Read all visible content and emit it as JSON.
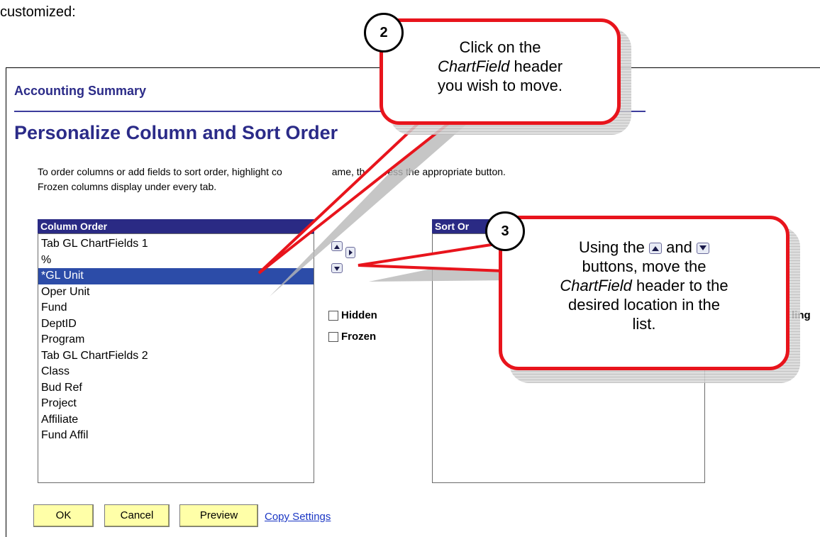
{
  "doc_text": "customized:",
  "page": {
    "breadcrumb": "Accounting Summary",
    "title": "Personalize Column and Sort Order",
    "instructions_line1_a": "To order columns or add fields to sort order, highlight co",
    "instructions_line1_b": "ame, then press the appropriate button.",
    "instructions_line2": "Frozen columns display under every tab."
  },
  "column_order": {
    "header": "Column Order",
    "items": [
      {
        "label": "Tab GL ChartFields 1",
        "selected": false
      },
      {
        "label": "%",
        "selected": false
      },
      {
        "label": "*GL Unit",
        "selected": true
      },
      {
        "label": "Oper Unit",
        "selected": false
      },
      {
        "label": "Fund",
        "selected": false
      },
      {
        "label": "DeptID",
        "selected": false
      },
      {
        "label": "Program",
        "selected": false
      },
      {
        "label": "Tab GL ChartFields 2",
        "selected": false
      },
      {
        "label": "Class",
        "selected": false
      },
      {
        "label": "Bud Ref",
        "selected": false
      },
      {
        "label": "Project",
        "selected": false
      },
      {
        "label": "Affiliate",
        "selected": false
      },
      {
        "label": "Fund Affil",
        "selected": false
      }
    ]
  },
  "controls": {
    "hidden_label": "Hidden",
    "frozen_label": "Frozen",
    "move_up_icon": "triangle-up-icon",
    "move_down_icon": "triangle-down-icon",
    "add_to_sort_icon": "triangle-right-icon"
  },
  "sort_order": {
    "header_partial": "Sort Or",
    "right_label_partial": "ling"
  },
  "buttons": {
    "ok": "OK",
    "cancel": "Cancel",
    "preview": "Preview",
    "copy_settings": "Copy Settings"
  },
  "callouts": {
    "step2": {
      "number": "2",
      "line1": "Click on the",
      "line2_italic": "ChartField",
      "line2_rest": " header",
      "line3": "you wish to move."
    },
    "step3": {
      "number": "3",
      "line1_a": "Using the",
      "line1_b": "and",
      "line2": "buttons, move the",
      "line3_italic": "ChartField",
      "line3_rest": " header to the",
      "line4": "desired location in the",
      "line5": "list."
    }
  },
  "colors": {
    "title_blue": "#2b2b88",
    "header_bg": "#2a2a84",
    "selection_bg": "#2c4ca8",
    "button_yellow": "#ffffa8",
    "callout_red": "#e8141c",
    "link_blue": "#1a36c4"
  }
}
